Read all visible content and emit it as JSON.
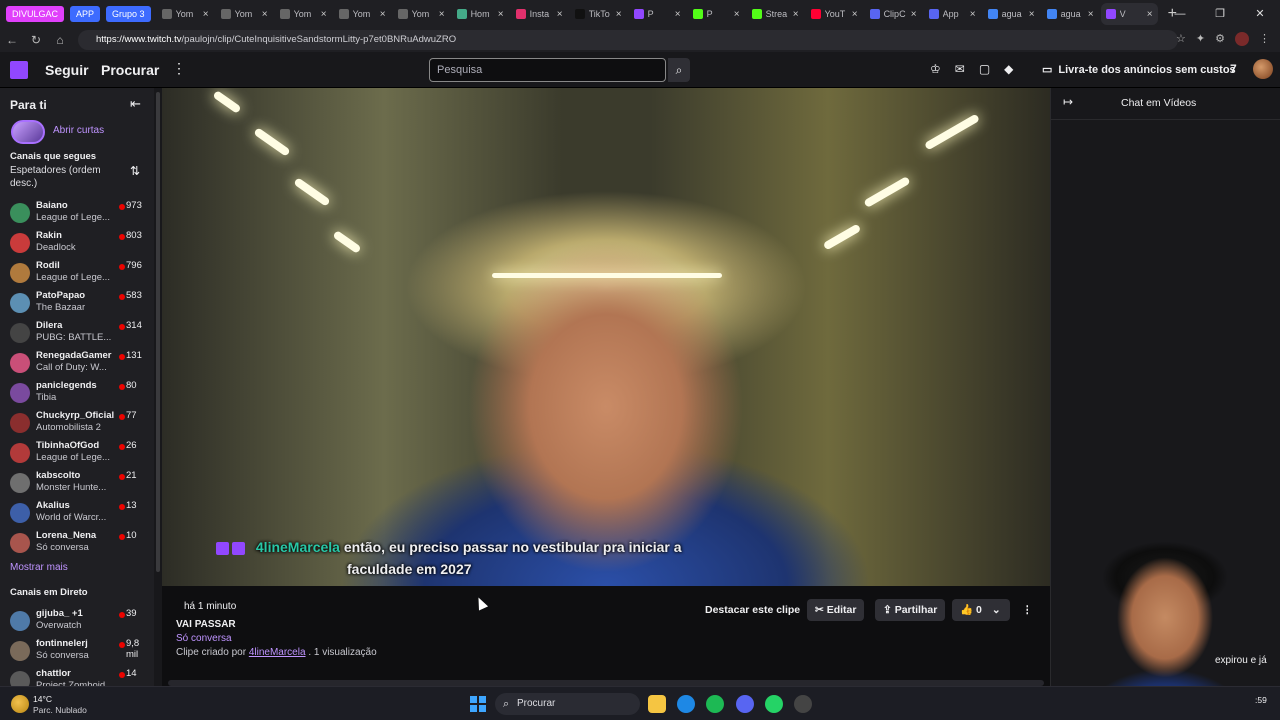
{
  "browser": {
    "tab_groups": [
      {
        "label": "DIVULGAC",
        "color": "#e040fb"
      },
      {
        "label": "APP",
        "color": "#3d6bff"
      },
      {
        "label": "Grupo 3",
        "color": "#3d6bff"
      }
    ],
    "tabs": [
      {
        "label": "Yom",
        "icon": "page-icon",
        "color": "#666"
      },
      {
        "label": "Yom",
        "icon": "page-icon",
        "color": "#666"
      },
      {
        "label": "Yom",
        "icon": "page-icon",
        "color": "#666"
      },
      {
        "label": "Yom",
        "icon": "page-icon",
        "color": "#666"
      },
      {
        "label": "Yom",
        "icon": "page-icon",
        "color": "#666"
      },
      {
        "label": "Hom",
        "icon": "page-icon",
        "color": "#4a8"
      },
      {
        "label": "Insta",
        "icon": "instagram-icon",
        "color": "#e1306c"
      },
      {
        "label": "TikTo",
        "icon": "tiktok-icon",
        "color": "#111"
      },
      {
        "label": "P",
        "icon": "twitch-icon",
        "color": "#9147ff"
      },
      {
        "label": "P",
        "icon": "kick-icon",
        "color": "#53fc18"
      },
      {
        "label": "Strea",
        "icon": "kick-icon",
        "color": "#53fc18"
      },
      {
        "label": "YouT",
        "icon": "youtube-icon",
        "color": "#ff0033"
      },
      {
        "label": "ClipC",
        "icon": "app-icon",
        "color": "#5865f2"
      },
      {
        "label": "App",
        "icon": "app-icon",
        "color": "#5865f2"
      },
      {
        "label": "agua",
        "icon": "search-icon",
        "color": "#4285f4"
      },
      {
        "label": "agua",
        "icon": "search-icon",
        "color": "#4285f4"
      },
      {
        "label": "V",
        "icon": "twitch-icon",
        "color": "#9147ff"
      }
    ],
    "url_host": "https://www.twitch.tv",
    "url_path": "/paulojn/clip/CuteInquisitiveSandstormLitty-p7et0BNRuAdwuZRO"
  },
  "topnav": {
    "following": "Seguir",
    "browse": "Procurar",
    "search_placeholder": "Pesquisa",
    "prime_text": "Livra-te dos anúncios sem custos"
  },
  "sidebar": {
    "title": "Para ti",
    "shorts_label": "Abrir curtas",
    "followed_title": "Canais que segues",
    "sort_label": "Espetadores (ordem desc.)",
    "channels": [
      {
        "name": "Baiano",
        "game": "League of Lege...",
        "viewers": "973",
        "color": "#3a8f5c"
      },
      {
        "name": "Rakin",
        "game": "Deadlock",
        "viewers": "803",
        "color": "#c93b3b"
      },
      {
        "name": "Rodil",
        "game": "League of Lege...",
        "viewers": "796",
        "color": "#b07a3d"
      },
      {
        "name": "PatoPapao",
        "game": "The Bazaar",
        "viewers": "583",
        "color": "#5c8fb3"
      },
      {
        "name": "Dilera",
        "game": "PUBG: BATTLE...",
        "viewers": "314",
        "color": "#444"
      },
      {
        "name": "RenegadaGamer",
        "game": "Call of Duty: W...",
        "viewers": "131",
        "color": "#c94f78"
      },
      {
        "name": "paniclegends",
        "game": "Tibia",
        "viewers": "80",
        "color": "#7a4a9e"
      },
      {
        "name": "Chuckyrp_Oficial",
        "game": "Automobilista 2",
        "viewers": "77",
        "color": "#8a2e2e"
      },
      {
        "name": "TibinhaOfGod",
        "game": "League of Lege...",
        "viewers": "26",
        "color": "#b23a3a"
      },
      {
        "name": "kabscolto",
        "game": "Monster Hunte...",
        "viewers": "21",
        "color": "#6f6f6f"
      },
      {
        "name": "Akalius",
        "game": "World of Warcr...",
        "viewers": "13",
        "color": "#3d5fa8"
      },
      {
        "name": "Lorena_Nena",
        "game": "Só conversa",
        "viewers": "10",
        "color": "#a8554d"
      }
    ],
    "show_more": "Mostrar mais",
    "live_title": "Canais em Direto",
    "live_channels": [
      {
        "name": "gijuba_ +1",
        "game": "Overwatch",
        "viewers": "39",
        "color": "#4f7aa8"
      },
      {
        "name": "fontinnelerj",
        "game": "Só conversa",
        "viewers": "9,8 mil",
        "color": "#7a6a5a"
      },
      {
        "name": "chattlor",
        "game": "Project Zomboid",
        "viewers": "14",
        "color": "#5a5a5a"
      }
    ]
  },
  "video": {
    "chat_user": "4lineMarcela",
    "chat_msg_line1": "então, eu preciso passar no vestibular pra iniciar a",
    "chat_msg_line2": "faculdade em 2027"
  },
  "clip": {
    "time_ago": "há 1 minuto",
    "title": "VAI PASSAR",
    "category": "Só conversa",
    "created_by_prefix": "Clipe criado por",
    "creator": "4lineMarcela",
    "views": ". 1 visualização",
    "feature_btn": "Destacar este clipe",
    "edit_btn": "Editar",
    "share_btn": "Partilhar",
    "likes": "0"
  },
  "chat": {
    "title": "Chat em Vídeos",
    "snippet": "expirou e já"
  },
  "taskbar": {
    "temp": "14°C",
    "weather": "Parc. Nublado",
    "search": "Procurar",
    "clock": ":59"
  }
}
